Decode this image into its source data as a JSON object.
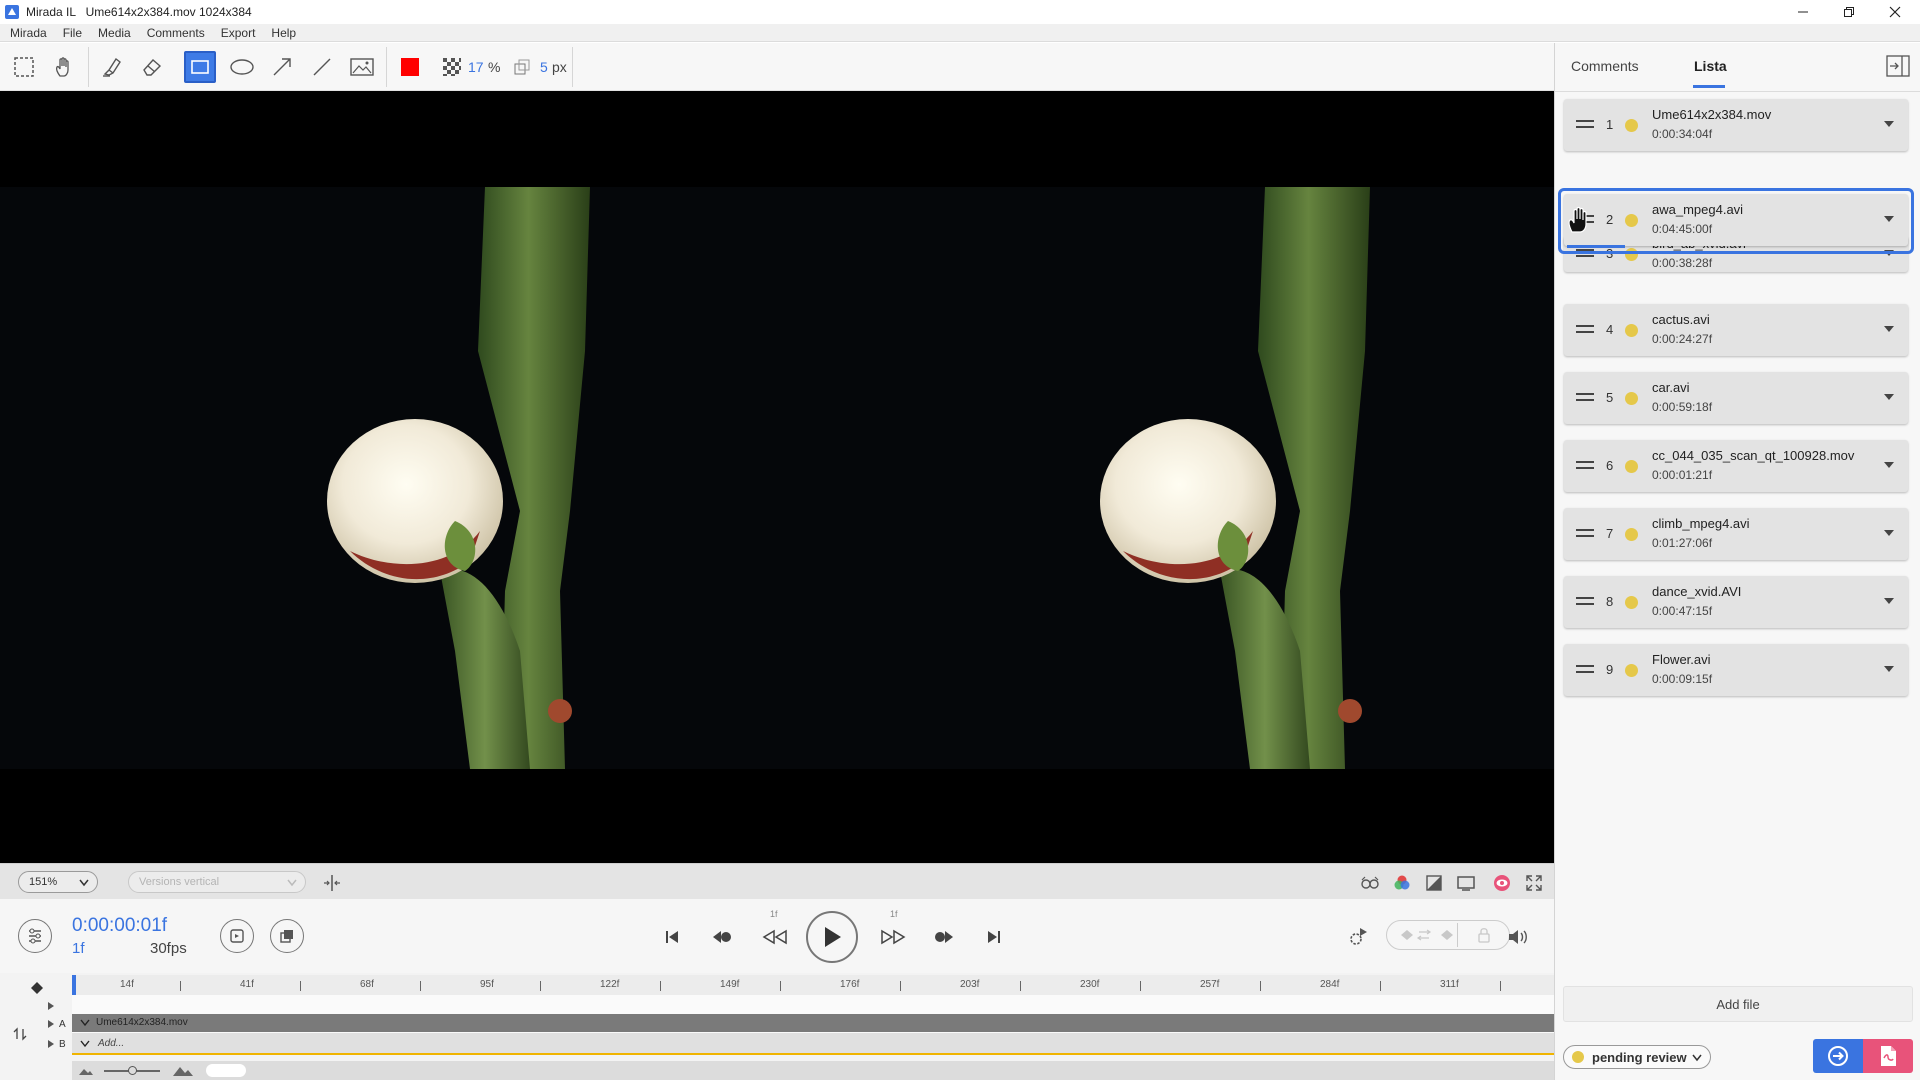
{
  "window": {
    "title": "Mirada IL   Ume614x2x384.mov 1024x384"
  },
  "menu": [
    "Mirada",
    "File",
    "Media",
    "Comments",
    "Export",
    "Help"
  ],
  "toolbar": {
    "grid_opacity": "17",
    "grid_unit": "%",
    "stroke_width": "5",
    "stroke_unit": "px",
    "stroke_color": "#ff0000"
  },
  "viewbar": {
    "zoom": "151%",
    "layout_mode": "Versions vertical"
  },
  "transport": {
    "timecode": "0:00:00:01f",
    "frame": "1f",
    "fps": "30fps",
    "step_back_label": "1f",
    "step_fwd_label": "1f"
  },
  "timeline": {
    "ticks": [
      "14f",
      "41f",
      "68f",
      "95f",
      "122f",
      "149f",
      "176f",
      "203f",
      "230f",
      "257f",
      "284f",
      "311f"
    ],
    "track_a_label": "A",
    "track_b_label": "B",
    "track_a_clip": "Ume614x2x384.mov",
    "track_b_clip": "Add..."
  },
  "panel": {
    "tabs": [
      "Comments",
      "Lista"
    ],
    "active_tab": "Lista",
    "items": [
      {
        "num": "1",
        "name": "Ume614x2x384.mov",
        "duration": "0:00:34:04f"
      },
      {
        "num": "2",
        "name": "awa_mpeg4.avi",
        "duration": "0:04:45:00f"
      },
      {
        "num": "3",
        "name": "bird_ab_xvid.avi",
        "duration": "0:00:38:28f"
      },
      {
        "num": "4",
        "name": "cactus.avi",
        "duration": "0:00:24:27f"
      },
      {
        "num": "5",
        "name": "car.avi",
        "duration": "0:00:59:18f"
      },
      {
        "num": "6",
        "name": "cc_044_035_scan_qt_100928.mov",
        "duration": "0:00:01:21f"
      },
      {
        "num": "7",
        "name": "climb_mpeg4.avi",
        "duration": "0:01:27:06f"
      },
      {
        "num": "8",
        "name": "dance_xvid.AVI",
        "duration": "0:00:47:15f"
      },
      {
        "num": "9",
        "name": "Flower.avi",
        "duration": "0:00:09:15f"
      }
    ],
    "add_file": "Add file",
    "status": "pending review",
    "status_color": "#e5c84a"
  },
  "colors": {
    "accent": "#3a74e0",
    "export_pdf": "#e8537a"
  }
}
